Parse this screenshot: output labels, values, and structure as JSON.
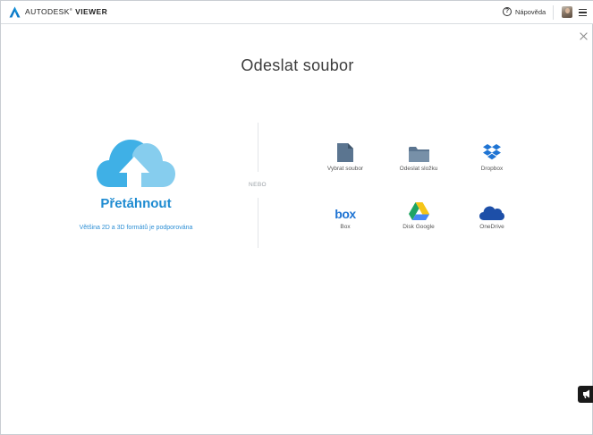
{
  "header": {
    "brand_name": "AUTODESK",
    "brand_mark": "®",
    "product_name": "VIEWER",
    "help_glyph": "?",
    "help_label": "Nápověda"
  },
  "main": {
    "title": "Odeslat soubor",
    "drag_label": "Přetáhnout",
    "formats_note": "Většina 2D a 3D formátů je podporována",
    "or_label": "NEBO"
  },
  "sources": [
    {
      "label": "Vybrat soubor",
      "icon": "file-icon"
    },
    {
      "label": "Odeslat složku",
      "icon": "folder-icon"
    },
    {
      "label": "Dropbox",
      "icon": "dropbox-icon"
    },
    {
      "label": "Box",
      "icon": "box-icon",
      "logo_text": "box"
    },
    {
      "label": "Disk Google",
      "icon": "google-drive-icon"
    },
    {
      "label": "OneDrive",
      "icon": "onedrive-icon"
    }
  ],
  "colors": {
    "accent_blue": "#1e8bd1",
    "cloud_dark": "#3fb0e6",
    "cloud_light": "#86cdee",
    "icon_slate": "#5b7590",
    "dropbox_blue": "#1f74d3",
    "onedrive_blue": "#1d4fa8"
  }
}
